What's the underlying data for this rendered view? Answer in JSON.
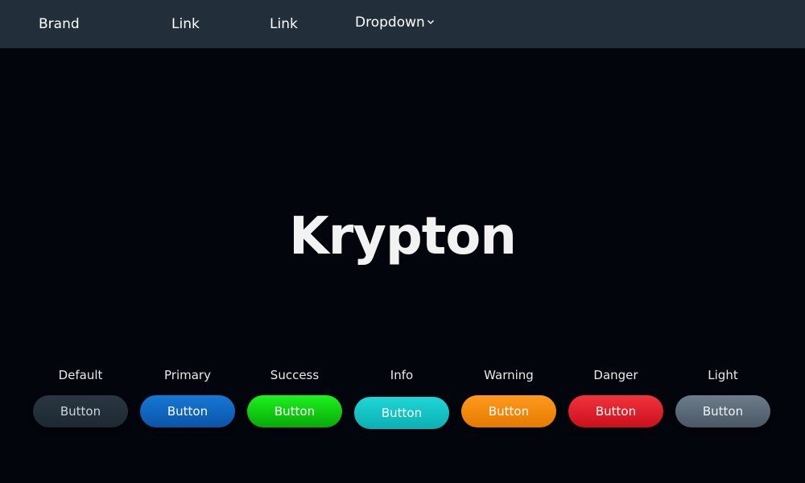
{
  "navbar": {
    "brand": "Brand",
    "links": [
      "Link",
      "Link"
    ],
    "dropdown": "Dropdown",
    "dropdown_icon": "chevron-down-icon"
  },
  "hero": {
    "title": "Krypton"
  },
  "buttons": [
    {
      "label": "Default",
      "text": "Button",
      "color": "#222f3a"
    },
    {
      "label": "Primary",
      "text": "Button",
      "color": "#0d6bc4"
    },
    {
      "label": "Success",
      "text": "Button",
      "color": "#12cc12"
    },
    {
      "label": "Info",
      "text": "Button",
      "color": "#14c4c6"
    },
    {
      "label": "Warning",
      "text": "Button",
      "color": "#f58a0e"
    },
    {
      "label": "Danger",
      "text": "Button",
      "color": "#e0202a"
    },
    {
      "label": "Light",
      "text": "Button",
      "color": "#5a6977"
    }
  ],
  "colors": {
    "background": "#02050b",
    "navbar": "#222f3a",
    "text": "#ffffff"
  }
}
